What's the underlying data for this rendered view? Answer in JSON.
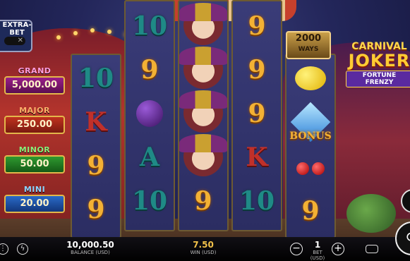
{
  "extra_bet": {
    "label": "EXTRA-BET",
    "toggle_symbol": "✕"
  },
  "jackpots": [
    {
      "name": "GRAND",
      "value": "5,000.00"
    },
    {
      "name": "MAJOR",
      "value": "250.00"
    },
    {
      "name": "MINOR",
      "value": "50.00"
    },
    {
      "name": "MINI",
      "value": "20.00"
    }
  ],
  "ways": {
    "count": "2000",
    "label": "WAYS"
  },
  "logo": {
    "line1": "CARNIVAL",
    "line2": "JOKER",
    "line3": "FORTUNE FRENZY"
  },
  "reels": {
    "reel1": [
      "10",
      "K",
      "9",
      "9"
    ],
    "reel2": [
      "10",
      "9",
      "plum",
      "A",
      "10"
    ],
    "reel3": [
      "joker",
      "joker",
      "joker",
      "joker",
      "9"
    ],
    "reel4": [
      "9",
      "9",
      "9",
      "K",
      "10"
    ],
    "reel5": [
      "lemon",
      "diamond",
      "BONUS",
      "cherry",
      "9"
    ]
  },
  "bottom_bar": {
    "balance_value": "10,000.50",
    "balance_label": "BALANCE (USD)",
    "win_value": "7.50",
    "win_label": "WIN (USD)",
    "bet_value": "1",
    "bet_label": "BET (USD)",
    "minus": "−",
    "plus": "+"
  },
  "colors": {
    "gold": "#f3b134",
    "teal": "#1f8a86",
    "red": "#c0302a"
  }
}
